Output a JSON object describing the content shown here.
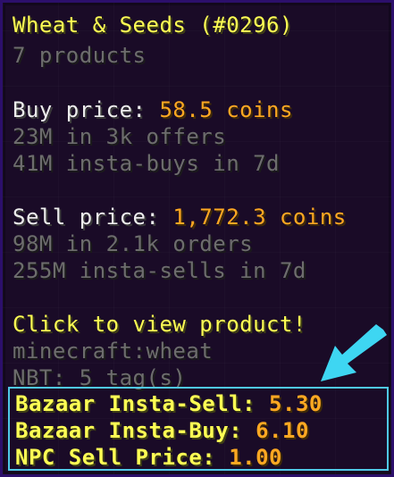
{
  "tooltip": {
    "title": "Wheat & Seeds (#0296)",
    "subtitle": "7 products",
    "buy_label": "Buy price: ",
    "buy_value": "58.5 coins",
    "buy_offers": "23M in 3k offers",
    "buy_insta": "41M insta-buys in 7d",
    "sell_label": "Sell price: ",
    "sell_value": "1,772.3 coins",
    "sell_orders": "98M in 2.1k orders",
    "sell_insta": "255M insta-sells in 7d",
    "click_hint": "Click to view product!",
    "item_id": "minecraft:wheat",
    "nbt": "NBT: 5 tag(s)"
  },
  "prices": {
    "insta_sell_label": "Bazaar Insta-Sell: ",
    "insta_sell_value": "5.30",
    "insta_buy_label": "Bazaar Insta-Buy: ",
    "insta_buy_value": "6.10",
    "npc_label": "NPC Sell Price: ",
    "npc_value": "1.00"
  },
  "colors": {
    "title": "#fefe54",
    "value": "#fea822",
    "muted": "#a6a6a6",
    "highlight_border": "#4fc9e6",
    "arrow": "#3ed6f2"
  },
  "icons": {
    "arrow": "arrow-down-left-icon"
  }
}
